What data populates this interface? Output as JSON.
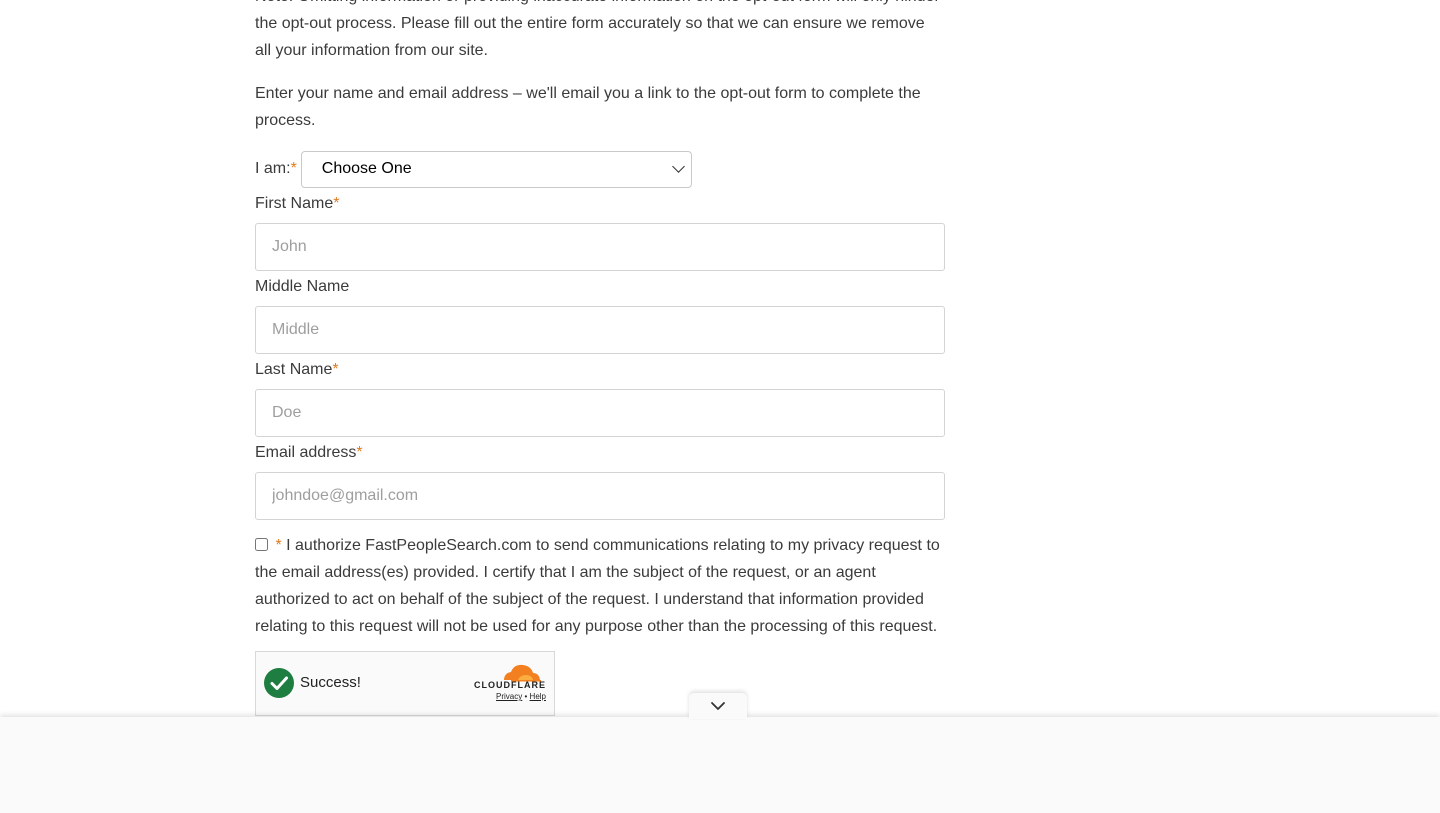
{
  "intro": {
    "para1": "Note: Omitting information or providing inaccurate information on the opt-out form will only hinder the opt-out process. Please fill out the entire form accurately so that we can ensure we remove all your information from our site.",
    "para2": "Enter your name and email address – we'll email you a link to the opt-out form to complete the process."
  },
  "form": {
    "iam": {
      "label": "I am:",
      "required_mark": "*",
      "selected": "Choose One"
    },
    "first_name": {
      "label": "First Name",
      "required_mark": "*",
      "placeholder": "John"
    },
    "middle_name": {
      "label": "Middle Name",
      "placeholder": "Middle"
    },
    "last_name": {
      "label": "Last Name",
      "required_mark": "*",
      "placeholder": "Doe"
    },
    "email": {
      "label": "Email address",
      "required_mark": "*",
      "placeholder": "johndoe@gmail.com"
    },
    "authorize": {
      "required_mark": "*",
      "text": "I authorize FastPeopleSearch.com to send communications relating to my privacy request to the email address(es) provided. I certify that I am the subject of the request, or an agent authorized to act on behalf of the subject of the request. I understand that information provided relating to this request will not be used for any purpose other than the processing of this request."
    }
  },
  "captcha": {
    "status": "Success!",
    "brand": "CLOUDFLARE",
    "privacy": "Privacy",
    "separator": "•",
    "help": "Help",
    "icon": "check-circle-icon"
  },
  "colors": {
    "required": "#e07b20",
    "success_green": "#1e7d40",
    "cloudflare_orange": "#f38020"
  },
  "overlay": {
    "toggle_icon": "chevron-down-icon"
  }
}
